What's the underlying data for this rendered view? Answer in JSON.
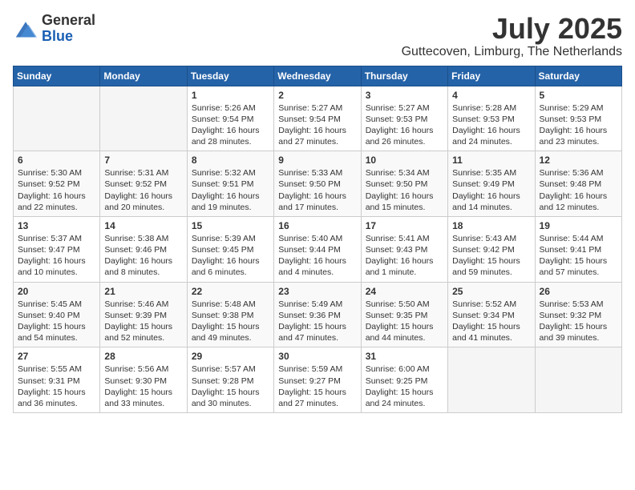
{
  "logo": {
    "general": "General",
    "blue": "Blue"
  },
  "header": {
    "month": "July 2025",
    "location": "Guttecoven, Limburg, The Netherlands"
  },
  "weekdays": [
    "Sunday",
    "Monday",
    "Tuesday",
    "Wednesday",
    "Thursday",
    "Friday",
    "Saturday"
  ],
  "weeks": [
    [
      {
        "day": "",
        "info": ""
      },
      {
        "day": "",
        "info": ""
      },
      {
        "day": "1",
        "info": "Sunrise: 5:26 AM\nSunset: 9:54 PM\nDaylight: 16 hours\nand 28 minutes."
      },
      {
        "day": "2",
        "info": "Sunrise: 5:27 AM\nSunset: 9:54 PM\nDaylight: 16 hours\nand 27 minutes."
      },
      {
        "day": "3",
        "info": "Sunrise: 5:27 AM\nSunset: 9:53 PM\nDaylight: 16 hours\nand 26 minutes."
      },
      {
        "day": "4",
        "info": "Sunrise: 5:28 AM\nSunset: 9:53 PM\nDaylight: 16 hours\nand 24 minutes."
      },
      {
        "day": "5",
        "info": "Sunrise: 5:29 AM\nSunset: 9:53 PM\nDaylight: 16 hours\nand 23 minutes."
      }
    ],
    [
      {
        "day": "6",
        "info": "Sunrise: 5:30 AM\nSunset: 9:52 PM\nDaylight: 16 hours\nand 22 minutes."
      },
      {
        "day": "7",
        "info": "Sunrise: 5:31 AM\nSunset: 9:52 PM\nDaylight: 16 hours\nand 20 minutes."
      },
      {
        "day": "8",
        "info": "Sunrise: 5:32 AM\nSunset: 9:51 PM\nDaylight: 16 hours\nand 19 minutes."
      },
      {
        "day": "9",
        "info": "Sunrise: 5:33 AM\nSunset: 9:50 PM\nDaylight: 16 hours\nand 17 minutes."
      },
      {
        "day": "10",
        "info": "Sunrise: 5:34 AM\nSunset: 9:50 PM\nDaylight: 16 hours\nand 15 minutes."
      },
      {
        "day": "11",
        "info": "Sunrise: 5:35 AM\nSunset: 9:49 PM\nDaylight: 16 hours\nand 14 minutes."
      },
      {
        "day": "12",
        "info": "Sunrise: 5:36 AM\nSunset: 9:48 PM\nDaylight: 16 hours\nand 12 minutes."
      }
    ],
    [
      {
        "day": "13",
        "info": "Sunrise: 5:37 AM\nSunset: 9:47 PM\nDaylight: 16 hours\nand 10 minutes."
      },
      {
        "day": "14",
        "info": "Sunrise: 5:38 AM\nSunset: 9:46 PM\nDaylight: 16 hours\nand 8 minutes."
      },
      {
        "day": "15",
        "info": "Sunrise: 5:39 AM\nSunset: 9:45 PM\nDaylight: 16 hours\nand 6 minutes."
      },
      {
        "day": "16",
        "info": "Sunrise: 5:40 AM\nSunset: 9:44 PM\nDaylight: 16 hours\nand 4 minutes."
      },
      {
        "day": "17",
        "info": "Sunrise: 5:41 AM\nSunset: 9:43 PM\nDaylight: 16 hours\nand 1 minute."
      },
      {
        "day": "18",
        "info": "Sunrise: 5:43 AM\nSunset: 9:42 PM\nDaylight: 15 hours\nand 59 minutes."
      },
      {
        "day": "19",
        "info": "Sunrise: 5:44 AM\nSunset: 9:41 PM\nDaylight: 15 hours\nand 57 minutes."
      }
    ],
    [
      {
        "day": "20",
        "info": "Sunrise: 5:45 AM\nSunset: 9:40 PM\nDaylight: 15 hours\nand 54 minutes."
      },
      {
        "day": "21",
        "info": "Sunrise: 5:46 AM\nSunset: 9:39 PM\nDaylight: 15 hours\nand 52 minutes."
      },
      {
        "day": "22",
        "info": "Sunrise: 5:48 AM\nSunset: 9:38 PM\nDaylight: 15 hours\nand 49 minutes."
      },
      {
        "day": "23",
        "info": "Sunrise: 5:49 AM\nSunset: 9:36 PM\nDaylight: 15 hours\nand 47 minutes."
      },
      {
        "day": "24",
        "info": "Sunrise: 5:50 AM\nSunset: 9:35 PM\nDaylight: 15 hours\nand 44 minutes."
      },
      {
        "day": "25",
        "info": "Sunrise: 5:52 AM\nSunset: 9:34 PM\nDaylight: 15 hours\nand 41 minutes."
      },
      {
        "day": "26",
        "info": "Sunrise: 5:53 AM\nSunset: 9:32 PM\nDaylight: 15 hours\nand 39 minutes."
      }
    ],
    [
      {
        "day": "27",
        "info": "Sunrise: 5:55 AM\nSunset: 9:31 PM\nDaylight: 15 hours\nand 36 minutes."
      },
      {
        "day": "28",
        "info": "Sunrise: 5:56 AM\nSunset: 9:30 PM\nDaylight: 15 hours\nand 33 minutes."
      },
      {
        "day": "29",
        "info": "Sunrise: 5:57 AM\nSunset: 9:28 PM\nDaylight: 15 hours\nand 30 minutes."
      },
      {
        "day": "30",
        "info": "Sunrise: 5:59 AM\nSunset: 9:27 PM\nDaylight: 15 hours\nand 27 minutes."
      },
      {
        "day": "31",
        "info": "Sunrise: 6:00 AM\nSunset: 9:25 PM\nDaylight: 15 hours\nand 24 minutes."
      },
      {
        "day": "",
        "info": ""
      },
      {
        "day": "",
        "info": ""
      }
    ]
  ]
}
